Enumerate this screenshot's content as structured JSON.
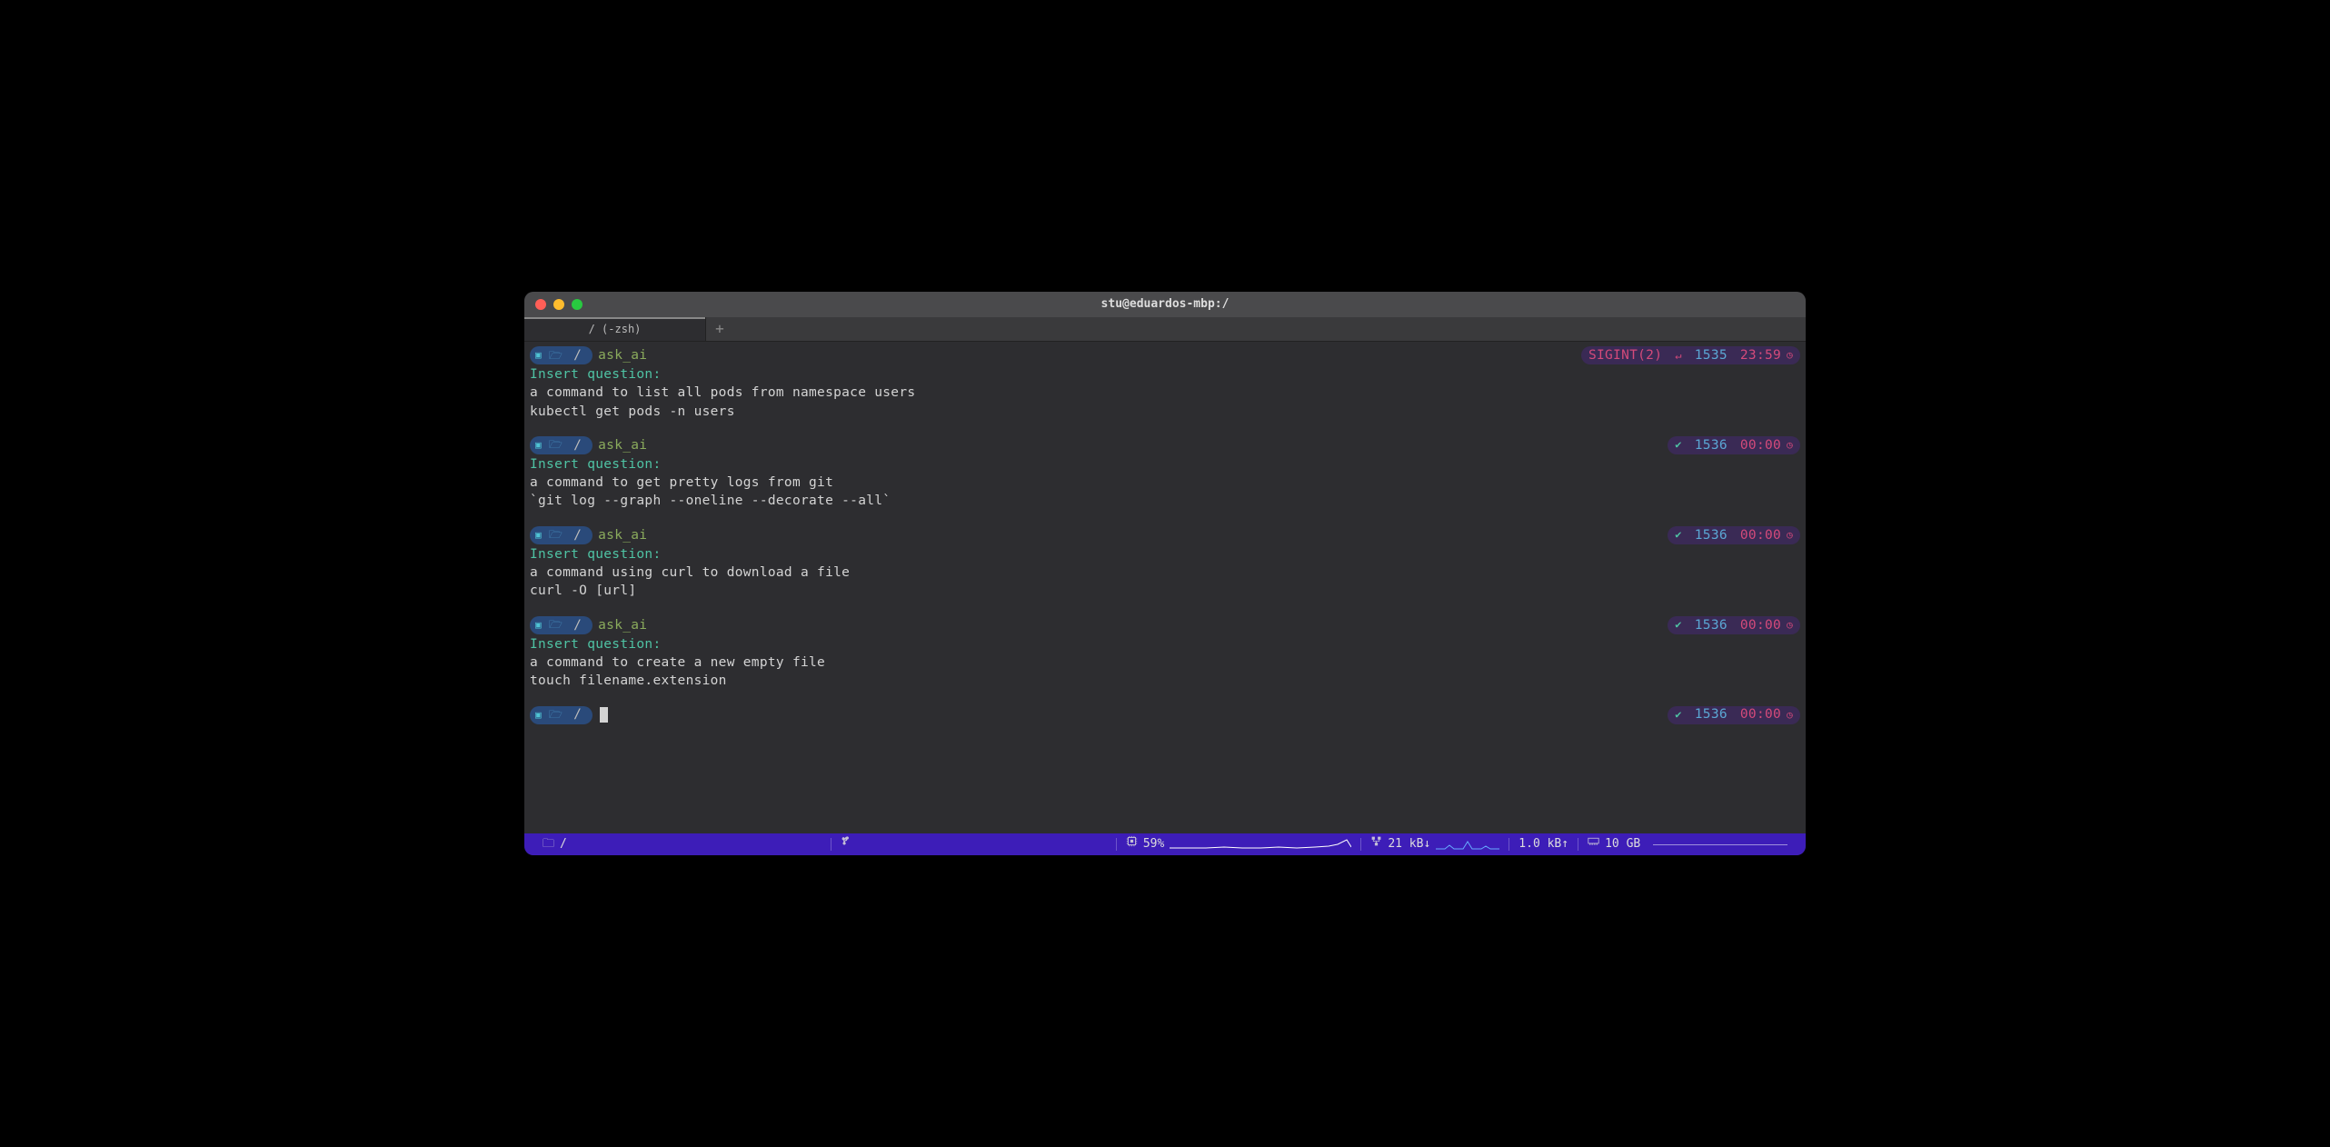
{
  "window": {
    "title": "stu@eduardos-mbp:/",
    "tab_label": "/ (-zsh)"
  },
  "blocks": [
    {
      "cmd": "ask_ai",
      "dir": "/",
      "question_label": "Insert question:",
      "question": "a command to list all pods from namespace users",
      "answer": "kubectl get pods -n users",
      "status": {
        "sigint": "SIGINT(2)",
        "count": "1535",
        "time": "23:59"
      }
    },
    {
      "cmd": "ask_ai",
      "dir": "/",
      "question_label": "Insert question:",
      "question": "a command to get pretty logs from git",
      "answer": "`git log --graph --oneline --decorate --all`",
      "status": {
        "check": true,
        "count": "1536",
        "time": "00:00"
      }
    },
    {
      "cmd": "ask_ai",
      "dir": "/",
      "question_label": "Insert question:",
      "question": "a command using curl to download a file",
      "answer": "curl -O [url]",
      "status": {
        "check": true,
        "count": "1536",
        "time": "00:00"
      }
    },
    {
      "cmd": "ask_ai",
      "dir": "/",
      "question_label": "Insert question:",
      "question": "a command to create a new empty file",
      "answer": "touch filename.extension",
      "status": {
        "check": true,
        "count": "1536",
        "time": "00:00"
      }
    }
  ],
  "current": {
    "dir": "/",
    "status": {
      "check": true,
      "count": "1536",
      "time": "00:00"
    }
  },
  "statusbar": {
    "folder": "/",
    "cpu": "59%",
    "net_down": "21 kB↓",
    "net_up": "1.0 kB↑",
    "ram": "10 GB"
  }
}
